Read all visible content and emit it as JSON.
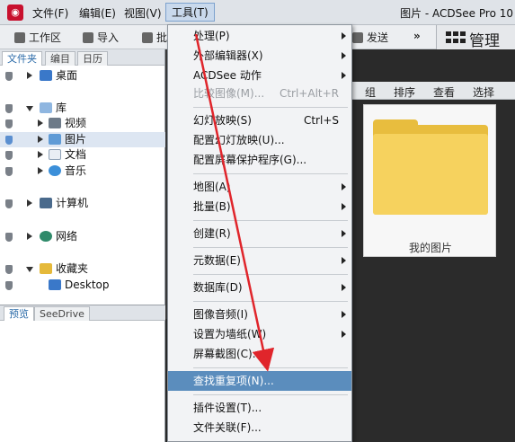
{
  "menubar": {
    "app_icon": "acdsee-logo-icon",
    "items": [
      {
        "label": "文件(F)"
      },
      {
        "label": "编辑(E)"
      },
      {
        "label": "视图(V)"
      },
      {
        "label": "工具(T)"
      }
    ],
    "window_title": "图片 - ACDSee Pro 10"
  },
  "toolbar": {
    "workspace": "工作区",
    "import": "导入",
    "batch": "批",
    "send": "发送",
    "more": "»",
    "manage": "管理"
  },
  "left_panel": {
    "tabs": [
      "文件夹",
      "编目",
      "日历"
    ],
    "tree": [
      {
        "label": "桌面",
        "icon": "desktop-icon"
      },
      {
        "label": "库",
        "icon": "library-icon"
      },
      {
        "label": "视频",
        "icon": "video-icon"
      },
      {
        "label": "图片",
        "icon": "picture-icon"
      },
      {
        "label": "文档",
        "icon": "document-icon"
      },
      {
        "label": "音乐",
        "icon": "music-icon"
      },
      {
        "label": "计算机",
        "icon": "computer-icon"
      },
      {
        "label": "网络",
        "icon": "network-icon"
      },
      {
        "label": "收藏夹",
        "icon": "favorites-icon"
      },
      {
        "label": "Desktop",
        "icon": "desktop-icon"
      }
    ],
    "bottom_tabs": [
      "预览",
      "SeeDrive"
    ]
  },
  "right_toolbar": [
    "组",
    "排序",
    "查看",
    "选择"
  ],
  "folder_tile": {
    "label": "我的图片"
  },
  "tools_menu": {
    "items": [
      {
        "label": "处理(P)",
        "submenu": true
      },
      {
        "label": "外部编辑器(X)",
        "submenu": true
      },
      {
        "label": "ACDSee 动作",
        "submenu": true
      },
      {
        "label": "比较图像(M)...",
        "shortcut": "Ctrl+Alt+R",
        "disabled": true
      },
      {
        "label": "幻灯放映(S)",
        "shortcut": "Ctrl+S"
      },
      {
        "label": "配置幻灯放映(U)..."
      },
      {
        "label": "配置屏幕保护程序(G)..."
      },
      {
        "label": "地图(A)",
        "submenu": true
      },
      {
        "label": "批量(B)",
        "submenu": true
      },
      {
        "label": "创建(R)",
        "submenu": true
      },
      {
        "label": "元数据(E)",
        "submenu": true
      },
      {
        "label": "数据库(D)",
        "submenu": true
      },
      {
        "label": "图像音频(I)",
        "submenu": true
      },
      {
        "label": "设置为墙纸(W)",
        "submenu": true
      },
      {
        "label": "屏幕截图(C)..."
      },
      {
        "label": "查找重复项(N)...",
        "highlighted": true
      },
      {
        "label": "插件设置(T)..."
      },
      {
        "label": "文件关联(F)..."
      }
    ]
  },
  "colors": {
    "menu_highlight": "#5b8dbd",
    "annotation_arrow": "#e0252b",
    "folder": "#f6d25e"
  }
}
